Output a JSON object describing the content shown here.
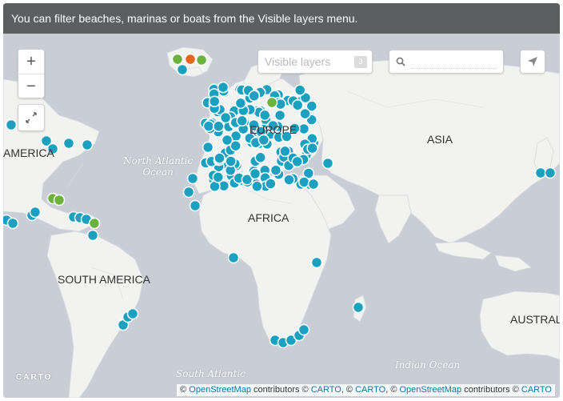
{
  "banner": {
    "text": "You can filter beaches, marinas or boats from the Visible layers menu."
  },
  "controls": {
    "zoom_in": "+",
    "zoom_out": "−",
    "visible_layers_label": "Visible layers",
    "visible_layers_count": "3",
    "search_value": "",
    "search_placeholder": ""
  },
  "labels": {
    "america": "AMERICA",
    "europe": "EUROPE",
    "asia": "ASIA",
    "africa": "AFRICA",
    "south_america": "SOUTH AMERICA",
    "australia": "AUSTRALI",
    "north_atlantic_1": "North Atlantic",
    "north_atlantic_2": "Ocean",
    "south_atlantic": "South Atlantic",
    "indian_ocean": "Indian Ocean",
    "carto_logo": "CARTO"
  },
  "attribution": {
    "c1": "© ",
    "osm1": "OpenStreetMap",
    "contrib1": " contributors © ",
    "carto1": "CARTO",
    "sep": ", © ",
    "carto2": "CARTO",
    "sep2": ", © ",
    "osm2": "OpenStreetMap",
    "contrib2": " contributors © ",
    "carto3": "CARTO"
  },
  "colors": {
    "water": "#c9ced6",
    "land": "#f2f2f0",
    "marker_blue": "#1ca0bf",
    "marker_green": "#6bb33e",
    "marker_orange": "#e4661f"
  },
  "icons": [
    "search-icon",
    "share-icon",
    "fullscreen-icon"
  ]
}
